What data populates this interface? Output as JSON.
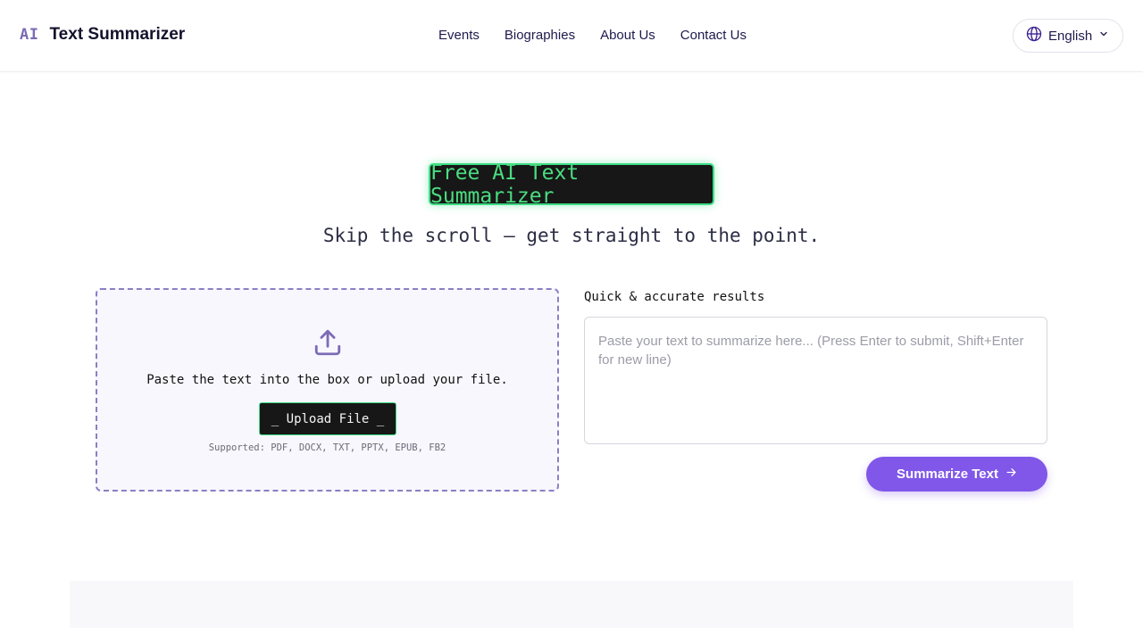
{
  "header": {
    "logo_mark": "AI",
    "logo_text": "Text Summarizer",
    "nav": [
      {
        "label": "Events"
      },
      {
        "label": "Biographies"
      },
      {
        "label": "About Us"
      },
      {
        "label": "Contact Us"
      }
    ],
    "language": {
      "label": "English",
      "icon": "globe-icon",
      "chevron": "chevron-down-icon"
    }
  },
  "hero": {
    "badge": "Free AI Text Summarizer",
    "subtitle": "Skip the scroll — get straight to the point."
  },
  "upload": {
    "icon": "upload-icon",
    "instruction": "Paste the text into the box or upload your file.",
    "button_label": "_ Upload File _",
    "supported": "Supported: PDF, DOCX, TXT, PPTX, EPUB, FB2"
  },
  "summarizer": {
    "label": "Quick & accurate results",
    "placeholder": "Paste your text to summarize here... (Press Enter to submit, Shift+Enter for new line)",
    "value": "",
    "submit_label": "Summarize Text",
    "submit_icon": "arrow-right-icon"
  },
  "colors": {
    "accent": "#8057e8",
    "badge_green": "#4ade80",
    "logo_purple": "#7c6bb5",
    "dark": "#171717"
  }
}
